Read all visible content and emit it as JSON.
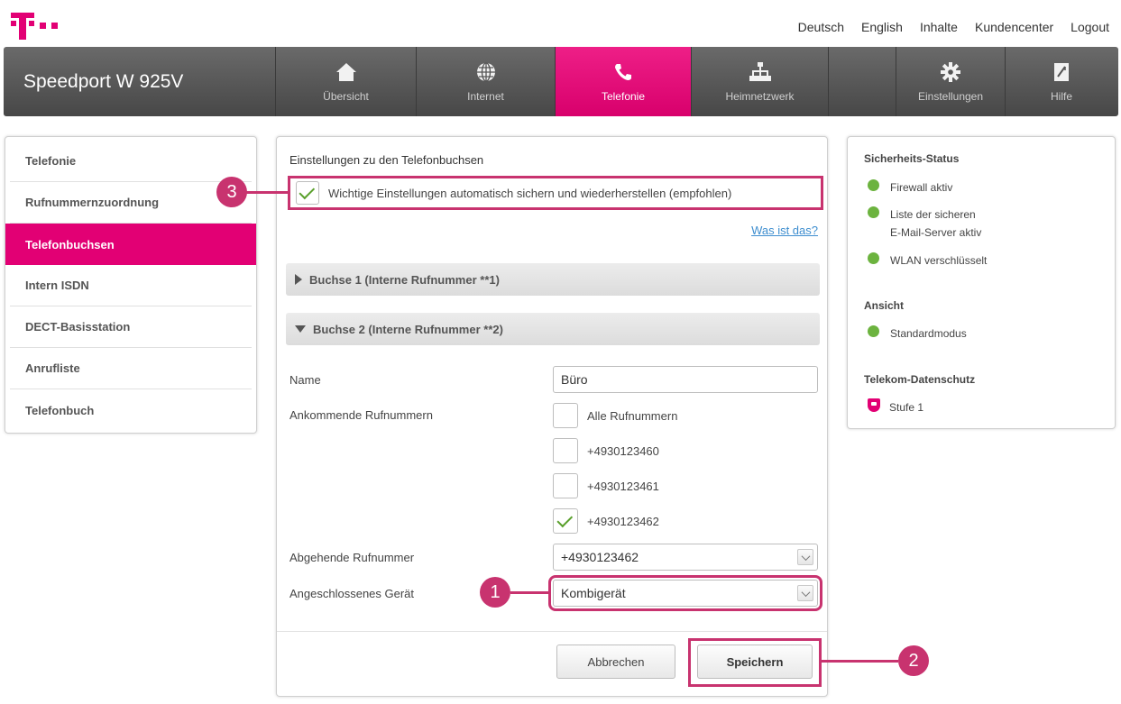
{
  "top_links": [
    "Deutsch",
    "English",
    "Inhalte",
    "Kundencenter",
    "Logout"
  ],
  "brand": "Speedport W 925V",
  "nav": [
    {
      "label": "Übersicht",
      "icon": "home-icon"
    },
    {
      "label": "Internet",
      "icon": "globe-icon"
    },
    {
      "label": "Telefonie",
      "icon": "phone-icon",
      "active": true
    },
    {
      "label": "Heimnetzwerk",
      "icon": "network-icon"
    },
    {
      "label": "Einstellungen",
      "icon": "gear-icon"
    },
    {
      "label": "Hilfe",
      "icon": "help-icon"
    }
  ],
  "sidebar": {
    "items": [
      {
        "label": "Telefonie"
      },
      {
        "label": "Rufnummernzuordnung"
      },
      {
        "label": "Telefonbuchsen",
        "active": true
      },
      {
        "label": "Intern ISDN"
      },
      {
        "label": "DECT-Basisstation"
      },
      {
        "label": "Anrufliste"
      },
      {
        "label": "Telefonbuch"
      }
    ]
  },
  "main": {
    "title": "Einstellungen zu den Telefonbuchsen",
    "auto_label": "Wichtige Einstellungen automatisch sichern und wiederherstellen (empfohlen)",
    "auto_checked": true,
    "help_link": "Was ist das?",
    "section1": "Buchse 1 (Interne Rufnummer **1)",
    "section2": "Buchse 2 (Interne Rufnummer **2)",
    "name_label": "Name",
    "name_value": "Büro",
    "incoming_label": "Ankommende Rufnummern",
    "incoming": [
      {
        "label": "Alle Rufnummern",
        "checked": false
      },
      {
        "label": "+4930123460",
        "checked": false
      },
      {
        "label": "+4930123461",
        "checked": false
      },
      {
        "label": "+4930123462",
        "checked": true
      }
    ],
    "outgoing_label": "Abgehende Rufnummer",
    "outgoing_value": "+4930123462",
    "device_label": "Angeschlossenes Gerät",
    "device_value": "Kombigerät",
    "cancel": "Abbrechen",
    "save": "Speichern"
  },
  "right": {
    "security_title": "Sicherheits-Status",
    "security_items": [
      {
        "lines": [
          "Firewall aktiv"
        ]
      },
      {
        "lines": [
          "Liste der sicheren",
          "E-Mail-Server aktiv"
        ]
      },
      {
        "lines": [
          "WLAN verschlüsselt"
        ]
      }
    ],
    "view_title": "Ansicht",
    "view_item": "Standardmodus",
    "privacy_title": "Telekom-Datenschutz",
    "privacy_item": "Stufe 1"
  },
  "callouts": [
    "1",
    "2",
    "3"
  ],
  "colors": {
    "magenta": "#e20074",
    "highlight": "#c8336f",
    "ok": "#6cb33f"
  }
}
